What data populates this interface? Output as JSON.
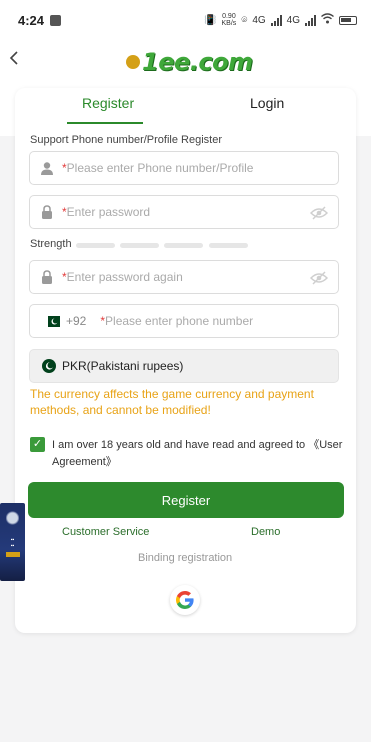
{
  "status_bar": {
    "time": "4:24",
    "speed_value": "0.90",
    "speed_unit": "KB/s",
    "network_1": "4G",
    "network_2": "4G"
  },
  "header": {
    "logo_text": "1ee.com"
  },
  "tabs": {
    "register": "Register",
    "login": "Login"
  },
  "form": {
    "section_label": "Support Phone number/Profile Register",
    "account_placeholder": "Please enter Phone number/Profile",
    "password_placeholder": "Enter password",
    "strength_label": "Strength",
    "confirm_placeholder": "Enter password again",
    "country_code": "+92",
    "phone_placeholder": "Please enter phone number",
    "required_mark": "*",
    "currency": "PKR(Pakistani rupees)",
    "currency_notice": "The currency affects the game currency and payment methods, and cannot be modified!",
    "agreement": "I am over 18 years old and have read and agreed to 《User Agreement》",
    "agreement_checked": true,
    "register_button": "Register"
  },
  "links": {
    "customer_service": "Customer Service",
    "demo": "Demo",
    "binding_registration": "Binding registration"
  },
  "colors": {
    "brand_green": "#2d8a2d",
    "notice_orange": "#e8a317",
    "required_red": "#e23b3b"
  },
  "icons": [
    "back-icon",
    "user-icon",
    "lock-icon",
    "eye-off-icon",
    "pakistan-flag-icon",
    "checkbox-icon",
    "google-icon"
  ]
}
